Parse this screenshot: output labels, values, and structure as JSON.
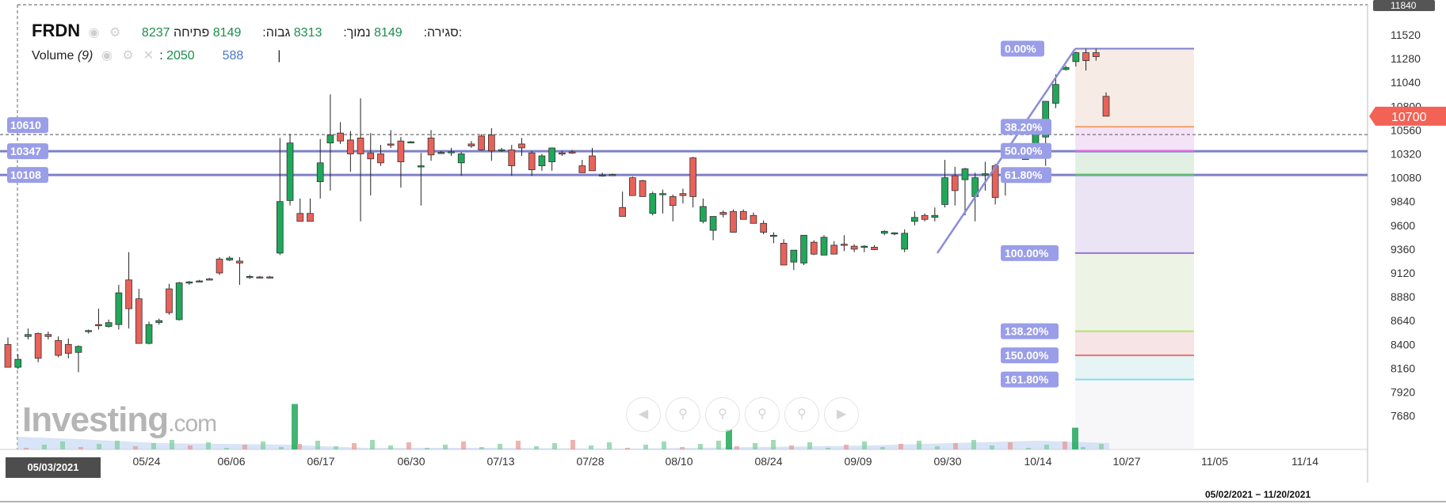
{
  "legend": {
    "ticker": "FRDN",
    "open_label": "פתיחה:",
    "open_value": "8149",
    "high_label": "גבוה:",
    "high_value": "8313",
    "low_label": "נמוך:",
    "low_value": "8149",
    "close_label": "סגירה:",
    "close_value": "8237",
    "volume_label": "Volume",
    "volume_period": "(9)",
    "volume_value": "2050",
    "volume_ma": "588",
    "cursor": "|"
  },
  "watermark": {
    "brand": "Investing",
    "suffix": ".com"
  },
  "colors": {
    "up": "#20a85a",
    "down": "#e8625a",
    "level_line": "#7e80c8",
    "price_tag": "#f26255",
    "label_bg": "#9a9ee8"
  },
  "icons": [
    "eye-icon",
    "gear-icon",
    "close-icon",
    "scroll-left-icon",
    "zoom-in-icon",
    "zoom-reset-icon",
    "zoom-out-icon",
    "zoom-fit-icon",
    "scroll-right-icon"
  ],
  "date_start": "05/03/2021",
  "date_range": "05/02/2021 − 11/20/2021",
  "chart_data": {
    "type": "candlestick",
    "ylim": [
      7500,
      11900
    ],
    "y_ticks": [
      "11520",
      "11280",
      "11040",
      "10800",
      "10560",
      "10320",
      "10080",
      "9840",
      "9600",
      "9360",
      "9120",
      "8880",
      "8640",
      "8400",
      "8160",
      "7920",
      "7680"
    ],
    "x_ticks": [
      "05/24",
      "06/06",
      "06/17",
      "06/30",
      "07/13",
      "07/28",
      "08/10",
      "08/24",
      "09/09",
      "09/30",
      "10/14",
      "10/27",
      "11/05",
      "11/14"
    ],
    "top_partial_tick": "11840",
    "last_price": "10700",
    "horizontal_levels": [
      {
        "label": "10610",
        "value": 10610,
        "dashed": true
      },
      {
        "label": "10347",
        "value": 10347,
        "dashed": false
      },
      {
        "label": "10108",
        "value": 10108,
        "dashed": false
      }
    ],
    "fibonacci": {
      "high": 11380,
      "low": 9320,
      "levels": [
        {
          "label": "0.00%",
          "ratio": 0,
          "color": "#7e80c8"
        },
        {
          "label": "38.20%",
          "ratio": 0.382,
          "color": "#f4a06a"
        },
        {
          "label": "50.00%",
          "ratio": 0.5,
          "color": "#e466e0"
        },
        {
          "label": "61.80%",
          "ratio": 0.618,
          "color": "#5ac85a"
        },
        {
          "label": "100.00%",
          "ratio": 1.0,
          "color": "#9b6fd6"
        },
        {
          "label": "138.20%",
          "ratio": 1.382,
          "color": "#b7e26b"
        },
        {
          "label": "150.00%",
          "ratio": 1.5,
          "color": "#f07070"
        },
        {
          "label": "161.80%",
          "ratio": 1.618,
          "color": "#7fe0e6"
        }
      ]
    },
    "candles": [
      [
        8400,
        8470,
        8180,
        8170
      ],
      [
        8170,
        8300,
        8150,
        8250
      ],
      [
        8480,
        8560,
        8450,
        8500
      ],
      [
        8510,
        8520,
        8220,
        8260
      ],
      [
        8500,
        8530,
        8450,
        8480
      ],
      [
        8440,
        8480,
        8270,
        8290
      ],
      [
        8400,
        8460,
        8260,
        8310
      ],
      [
        8320,
        8390,
        8120,
        8380
      ],
      [
        8530,
        8550,
        8510,
        8540
      ],
      [
        8600,
        8760,
        8550,
        8590
      ],
      [
        8580,
        8650,
        8570,
        8620
      ],
      [
        8600,
        9000,
        8550,
        8920
      ],
      [
        9050,
        9330,
        8560,
        8760
      ],
      [
        8860,
        8960,
        8720,
        8410
      ],
      [
        8410,
        8630,
        8400,
        8600
      ],
      [
        8620,
        8660,
        8600,
        8640
      ],
      [
        8960,
        9010,
        8700,
        8720
      ],
      [
        8650,
        9030,
        8640,
        9020
      ],
      [
        9020,
        9040,
        9000,
        9030
      ],
      [
        9040,
        9050,
        9030,
        9040
      ],
      [
        9060,
        9070,
        9050,
        9055
      ],
      [
        9260,
        9280,
        9100,
        9120
      ],
      [
        9250,
        9290,
        9240,
        9270
      ],
      [
        9240,
        9280,
        9000,
        9220
      ],
      [
        9080,
        9100,
        9060,
        9085
      ],
      [
        9080,
        9090,
        9070,
        9075
      ],
      [
        9080,
        9090,
        9070,
        9078
      ],
      [
        9320,
        10480,
        9300,
        9840
      ],
      [
        9850,
        10520,
        9800,
        10430
      ],
      [
        9720,
        9870,
        9660,
        9640
      ],
      [
        9720,
        9870,
        9660,
        9640
      ],
      [
        10040,
        10470,
        9870,
        10230
      ],
      [
        10430,
        10920,
        9950,
        10510
      ],
      [
        10530,
        10640,
        10420,
        10450
      ],
      [
        10460,
        10550,
        10140,
        10320
      ],
      [
        10480,
        10880,
        9640,
        10320
      ],
      [
        10330,
        10530,
        9900,
        10270
      ],
      [
        10320,
        10410,
        10200,
        10230
      ],
      [
        10420,
        10560,
        10380,
        10410
      ],
      [
        10450,
        10490,
        9980,
        10240
      ],
      [
        10440,
        10450,
        10430,
        10442
      ],
      [
        10190,
        10330,
        9800,
        10200
      ],
      [
        10480,
        10560,
        10250,
        10310
      ],
      [
        10330,
        10350,
        10320,
        10335
      ],
      [
        10340,
        10380,
        10300,
        10342
      ],
      [
        10230,
        10340,
        10100,
        10320
      ],
      [
        10420,
        10450,
        10380,
        10400
      ],
      [
        10500,
        10520,
        10350,
        10360
      ],
      [
        10510,
        10580,
        10250,
        10350
      ],
      [
        10360,
        10380,
        10340,
        10362
      ],
      [
        10360,
        10410,
        10100,
        10200
      ],
      [
        10420,
        10480,
        10300,
        10380
      ],
      [
        10330,
        10350,
        10100,
        10160
      ],
      [
        10200,
        10320,
        10150,
        10300
      ],
      [
        10240,
        10350,
        10150,
        10380
      ],
      [
        10330,
        10350,
        10300,
        10325
      ],
      [
        10340,
        10360,
        10320,
        10335
      ],
      [
        10200,
        10260,
        10140,
        10130
      ],
      [
        10300,
        10380,
        10210,
        10150
      ],
      [
        10100,
        10130,
        10090,
        10108
      ],
      [
        10110,
        10120,
        10100,
        10112
      ],
      [
        9780,
        9940,
        9760,
        9690
      ],
      [
        10080,
        10090,
        9900,
        9900
      ],
      [
        10050,
        10060,
        9890,
        9890
      ],
      [
        9720,
        9940,
        9700,
        9920
      ],
      [
        9920,
        9960,
        9720,
        9920
      ],
      [
        9890,
        9910,
        9640,
        9800
      ],
      [
        9920,
        9970,
        9820,
        9900
      ],
      [
        10280,
        10290,
        9780,
        9890
      ],
      [
        9640,
        9870,
        9620,
        9790
      ],
      [
        9550,
        9660,
        9450,
        9690
      ],
      [
        9730,
        9750,
        9680,
        9710
      ],
      [
        9740,
        9760,
        9640,
        9530
      ],
      [
        9740,
        9760,
        9660,
        9660
      ],
      [
        9700,
        9730,
        9620,
        9620
      ],
      [
        9620,
        9650,
        9510,
        9530
      ],
      [
        9490,
        9530,
        9420,
        9500
      ],
      [
        9420,
        9460,
        9200,
        9200
      ],
      [
        9230,
        9300,
        9150,
        9350
      ],
      [
        9220,
        9500,
        9200,
        9500
      ],
      [
        9430,
        9450,
        9300,
        9310
      ],
      [
        9300,
        9500,
        9300,
        9480
      ],
      [
        9400,
        9440,
        9330,
        9310
      ],
      [
        9410,
        9500,
        9340,
        9400
      ],
      [
        9390,
        9410,
        9330,
        9360
      ],
      [
        9380,
        9400,
        9330,
        9390
      ],
      [
        9380,
        9400,
        9350,
        9355
      ],
      [
        9520,
        9550,
        9500,
        9540
      ],
      [
        9520,
        9530,
        9500,
        9525
      ],
      [
        9360,
        9560,
        9330,
        9520
      ],
      [
        9640,
        9740,
        9600,
        9680
      ],
      [
        9700,
        9720,
        9640,
        9660
      ],
      [
        9680,
        9780,
        9640,
        9700
      ],
      [
        9810,
        10260,
        9780,
        10080
      ],
      [
        10100,
        10190,
        9800,
        9950
      ],
      [
        10060,
        10180,
        9700,
        10170
      ],
      [
        9890,
        10130,
        9640,
        10080
      ],
      [
        10120,
        10240,
        9950,
        10120
      ],
      [
        10200,
        10220,
        9810,
        9880
      ],
      [
        10070,
        10080,
        9900,
        10050
      ],
      [
        10170,
        10180,
        10080,
        10100
      ],
      [
        10270,
        10290,
        10260,
        10275
      ],
      [
        10340,
        10340,
        10280,
        10520
      ],
      [
        10490,
        10500,
        10200,
        10850
      ],
      [
        10830,
        11120,
        10780,
        11020
      ],
      [
        11170,
        11210,
        11160,
        11190
      ],
      [
        11250,
        11350,
        11200,
        11340
      ],
      [
        11340,
        11380,
        11160,
        11260
      ],
      [
        11340,
        11380,
        11260,
        11300
      ],
      [
        10900,
        10940,
        10700,
        10700
      ]
    ],
    "volume": [
      {
        "x": "06/14",
        "value": 2050
      },
      {
        "x": "08/15",
        "value": 900
      },
      {
        "x": "10/17",
        "value": 980
      }
    ]
  }
}
